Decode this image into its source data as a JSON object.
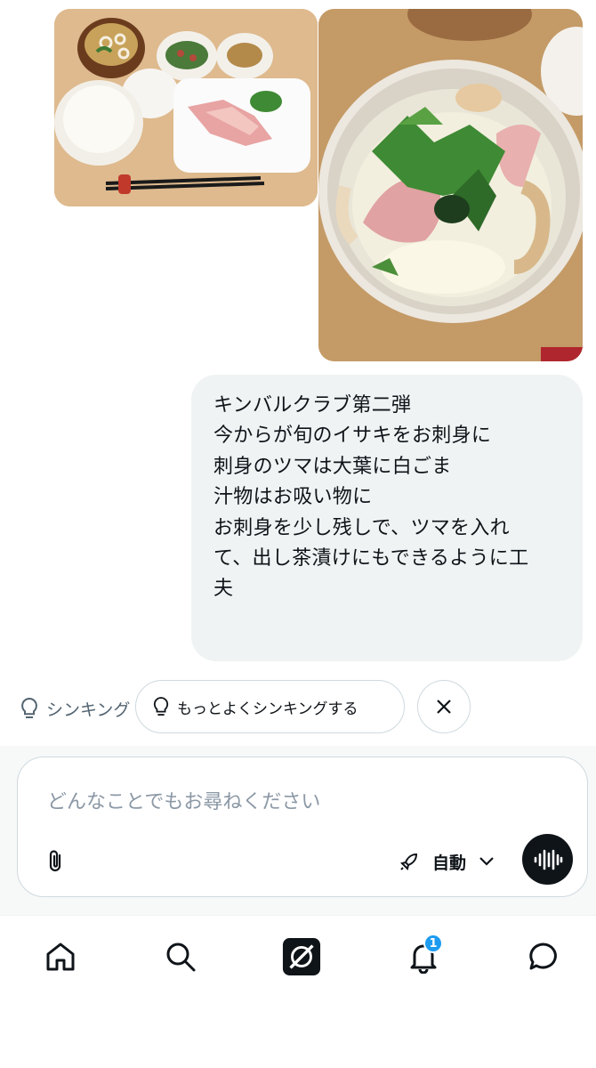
{
  "images": [
    {
      "name": "meal-photo-set",
      "icon": "food-photo"
    },
    {
      "name": "dashi-chazuke-photo",
      "icon": "food-photo"
    }
  ],
  "message": {
    "lines": [
      "キンバルクラブ第二弾",
      "今からが旬のイサキをお刺身に",
      "刺身のツマは大葉に白ごま",
      "汁物はお吸い物に",
      "お刺身を少し残しで、ツマを入れ",
      "て、出し茶漬けにもできるように工",
      "夫"
    ]
  },
  "suggestions": {
    "thinking_label": "シンキング",
    "deeper_thinking_button": "もっとよくシンキングする",
    "dismiss_icon": "close-icon"
  },
  "composer": {
    "placeholder": "どんなことでもお尋ねください",
    "value": "",
    "mode_label": "自動",
    "mode_icon": "rocket-icon",
    "attach_icon": "paperclip-icon",
    "voice_icon": "voice-wave-icon"
  },
  "nav": {
    "items": [
      "home",
      "search",
      "grok",
      "notifications",
      "messages"
    ],
    "notification_badge": "1"
  },
  "colors": {
    "bubble": "#eff3f4",
    "text": "#0f1419",
    "muted": "#536471",
    "badge": "#1d9bf0"
  }
}
